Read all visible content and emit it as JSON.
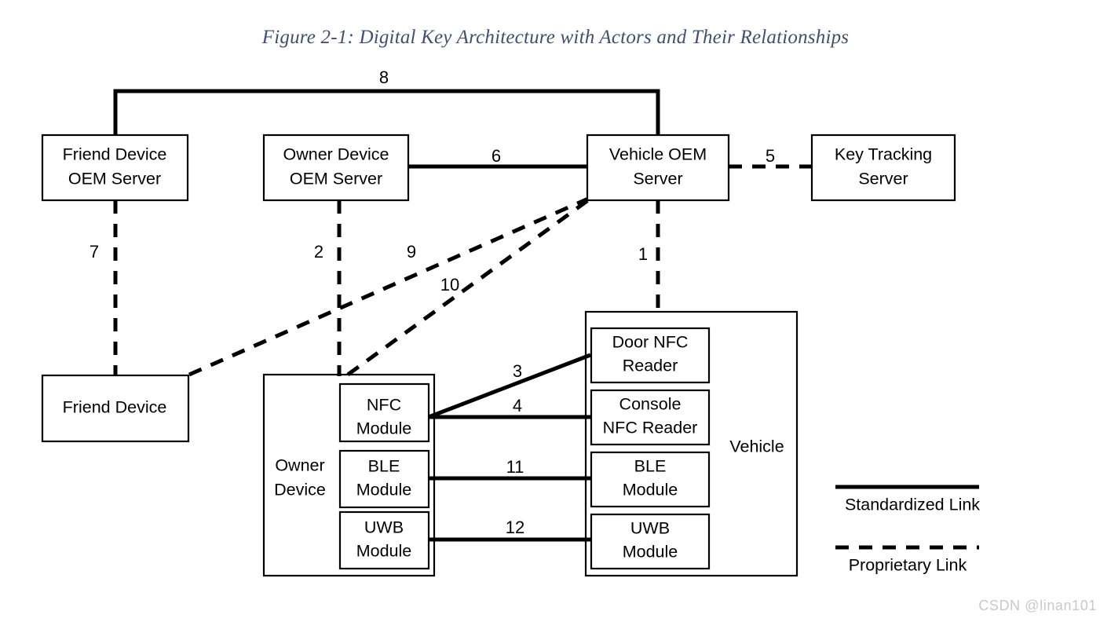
{
  "figure": {
    "title": "Figure 2-1: Digital Key Architecture with Actors and Their Relationships",
    "title_color": "#3f5070"
  },
  "nodes": {
    "friend_device_oem_server": {
      "line1": "Friend Device",
      "line2": "OEM Server"
    },
    "owner_device_oem_server": {
      "line1": "Owner Device",
      "line2": "OEM Server"
    },
    "vehicle_oem_server": {
      "line1": "Vehicle OEM",
      "line2": "Server"
    },
    "key_tracking_server": {
      "line1": "Key Tracking",
      "line2": "Server"
    },
    "friend_device": {
      "line1": "Friend Device"
    },
    "owner_device": {
      "line1": "Owner",
      "line2": "Device"
    },
    "vehicle": {
      "line1": "Vehicle"
    },
    "owner_nfc_module": {
      "line1": "NFC",
      "line2": "Module"
    },
    "owner_ble_module": {
      "line1": "BLE",
      "line2": "Module"
    },
    "owner_uwb_module": {
      "line1": "UWB",
      "line2": "Module"
    },
    "door_nfc_reader": {
      "line1": "Door NFC",
      "line2": "Reader"
    },
    "console_nfc_reader": {
      "line1": "Console",
      "line2": "NFC Reader"
    },
    "vehicle_ble_module": {
      "line1": "BLE",
      "line2": "Module"
    },
    "vehicle_uwb_module": {
      "line1": "UWB",
      "line2": "Module"
    }
  },
  "links": [
    {
      "id": "link-1",
      "label": "1",
      "style": "proprietary",
      "from": "vehicle-oem-server",
      "to": "vehicle"
    },
    {
      "id": "link-2",
      "label": "2",
      "style": "proprietary",
      "from": "owner-device-oem-server",
      "to": "owner-device"
    },
    {
      "id": "link-3",
      "label": "3",
      "style": "standardized",
      "from": "owner-nfc-module",
      "to": "door-nfc-reader"
    },
    {
      "id": "link-4",
      "label": "4",
      "style": "standardized",
      "from": "owner-nfc-module",
      "to": "console-nfc-reader"
    },
    {
      "id": "link-5",
      "label": "5",
      "style": "proprietary",
      "from": "vehicle-oem-server",
      "to": "key-tracking-server"
    },
    {
      "id": "link-6",
      "label": "6",
      "style": "standardized",
      "from": "owner-device-oem-server",
      "to": "vehicle-oem-server"
    },
    {
      "id": "link-7",
      "label": "7",
      "style": "proprietary",
      "from": "friend-device-oem-server",
      "to": "friend-device"
    },
    {
      "id": "link-8",
      "label": "8",
      "style": "standardized",
      "from": "friend-device-oem-server",
      "to": "vehicle-oem-server"
    },
    {
      "id": "link-9",
      "label": "9",
      "style": "proprietary",
      "from": "friend-device",
      "to": "vehicle-oem-server"
    },
    {
      "id": "link-10",
      "label": "10",
      "style": "proprietary",
      "from": "owner-device",
      "to": "vehicle-oem-server"
    },
    {
      "id": "link-11",
      "label": "11",
      "style": "standardized",
      "from": "owner-ble-module",
      "to": "vehicle-ble-module"
    },
    {
      "id": "link-12",
      "label": "12",
      "style": "standardized",
      "from": "owner-uwb-module",
      "to": "vehicle-uwb-module"
    }
  ],
  "legend": {
    "standardized": "Standardized Link",
    "proprietary": "Proprietary Link"
  },
  "watermark": "CSDN @linan101"
}
